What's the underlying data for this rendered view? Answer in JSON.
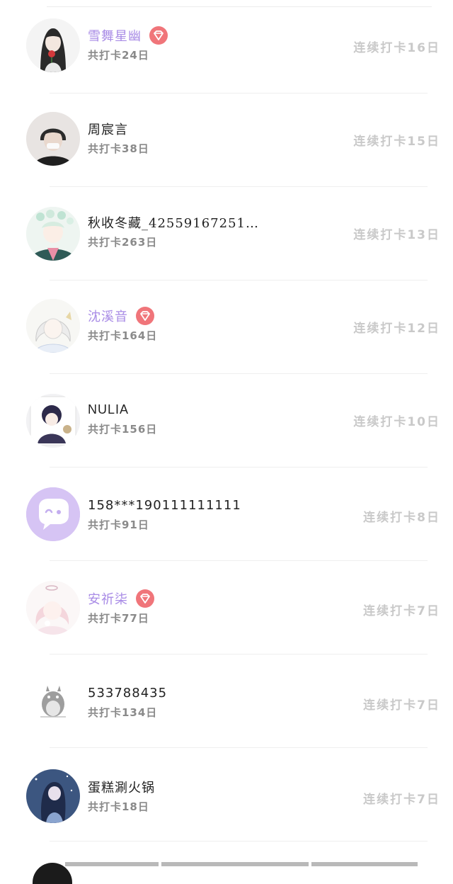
{
  "colors": {
    "vip_name": "#a98ce6",
    "name": "#222222",
    "total": "#8a8a8a",
    "streak": "#c9c9c9",
    "badge": "#f0757a",
    "divider": "#eeeeee"
  },
  "entries": [
    {
      "name": "雪舞星幽",
      "vip": true,
      "total": "共打卡24日",
      "streak": "连续打卡16日",
      "avatar_icon": "girl-with-rose-avatar"
    },
    {
      "name": "周宸言",
      "vip": false,
      "total": "共打卡38日",
      "streak": "连续打卡15日",
      "avatar_icon": "boy-with-mask-avatar"
    },
    {
      "name": "秋收冬藏_42559167251…",
      "vip": false,
      "total": "共打卡263日",
      "streak": "连续打卡13日",
      "avatar_icon": "flower-crown-anime-avatar"
    },
    {
      "name": "沈溪音",
      "vip": true,
      "total": "共打卡164日",
      "streak": "连续打卡12日",
      "avatar_icon": "white-hair-anime-avatar"
    },
    {
      "name": "NULIA",
      "vip": false,
      "total": "共打卡156日",
      "streak": "连续打卡10日",
      "avatar_icon": "chibi-anime-avatar"
    },
    {
      "name": "158***190111111111",
      "vip": false,
      "total": "共打卡91日",
      "streak": "连续打卡8日",
      "avatar_icon": "default-chat-bubble-avatar"
    },
    {
      "name": "安祈柒",
      "vip": true,
      "total": "共打卡77日",
      "streak": "连续打卡7日",
      "avatar_icon": "pink-hair-anime-avatar"
    },
    {
      "name": "533788435",
      "vip": false,
      "total": "共打卡134日",
      "streak": "连续打卡7日",
      "avatar_icon": "totoro-sketch-avatar"
    },
    {
      "name": "蛋糕涮火锅",
      "vip": false,
      "total": "共打卡18日",
      "streak": "连续打卡7日",
      "avatar_icon": "night-sky-anime-avatar"
    }
  ]
}
